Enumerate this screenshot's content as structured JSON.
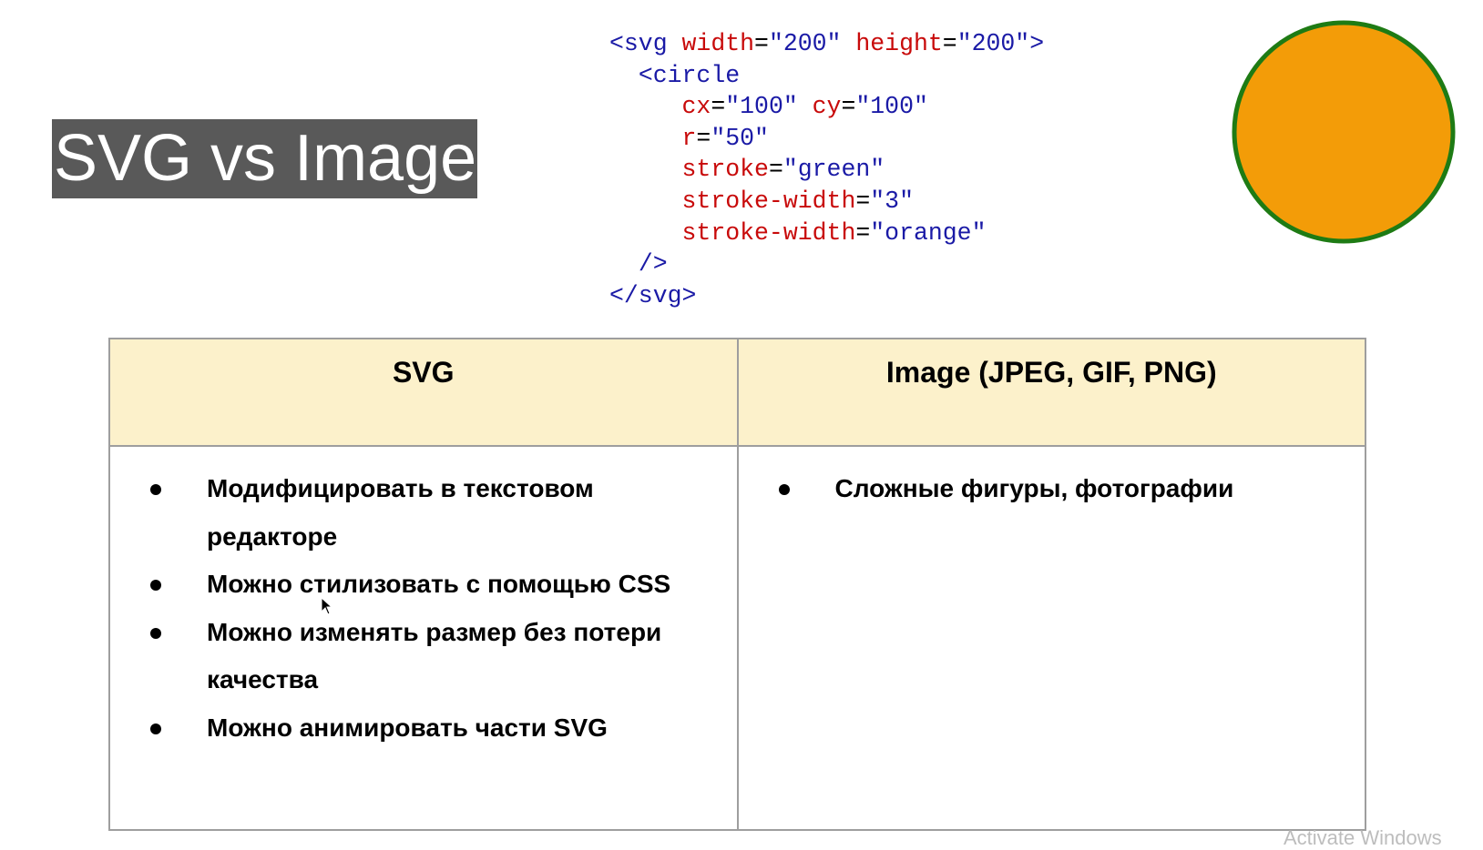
{
  "slide": {
    "title": "SVG vs Image"
  },
  "code": {
    "lines": [
      [
        {
          "t": "tag",
          "v": "<svg "
        },
        {
          "t": "attr",
          "v": "width"
        },
        {
          "t": "punct",
          "v": "="
        },
        {
          "t": "val",
          "v": "\"200\" "
        },
        {
          "t": "attr",
          "v": "height"
        },
        {
          "t": "punct",
          "v": "="
        },
        {
          "t": "val",
          "v": "\"200\">"
        }
      ],
      [
        {
          "t": "punct",
          "v": "  "
        },
        {
          "t": "tag",
          "v": "<circle"
        }
      ],
      [
        {
          "t": "punct",
          "v": "     "
        },
        {
          "t": "attr",
          "v": "cx"
        },
        {
          "t": "punct",
          "v": "="
        },
        {
          "t": "val",
          "v": "\"100\" "
        },
        {
          "t": "attr",
          "v": "cy"
        },
        {
          "t": "punct",
          "v": "="
        },
        {
          "t": "val",
          "v": "\"100\""
        }
      ],
      [
        {
          "t": "punct",
          "v": "     "
        },
        {
          "t": "attr",
          "v": "r"
        },
        {
          "t": "punct",
          "v": "="
        },
        {
          "t": "val",
          "v": "\"50\""
        }
      ],
      [
        {
          "t": "punct",
          "v": "     "
        },
        {
          "t": "attr",
          "v": "stroke"
        },
        {
          "t": "punct",
          "v": "="
        },
        {
          "t": "val",
          "v": "\"green\""
        }
      ],
      [
        {
          "t": "punct",
          "v": "     "
        },
        {
          "t": "attr",
          "v": "stroke-width"
        },
        {
          "t": "punct",
          "v": "="
        },
        {
          "t": "val",
          "v": "\"3\""
        }
      ],
      [
        {
          "t": "punct",
          "v": "     "
        },
        {
          "t": "attr",
          "v": "stroke-width"
        },
        {
          "t": "punct",
          "v": "="
        },
        {
          "t": "val",
          "v": "\"orange\""
        }
      ],
      [
        {
          "t": "punct",
          "v": "  "
        },
        {
          "t": "tag",
          "v": "/>"
        }
      ],
      [
        {
          "t": "tag",
          "v": "</svg>"
        }
      ]
    ]
  },
  "circle": {
    "fill": "#f39c08",
    "stroke": "#1e7b14"
  },
  "table": {
    "headers": [
      "SVG",
      "Image (JPEG, GIF, PNG)"
    ],
    "svg_points": [
      "Модифицировать в текстовом редакторе",
      "Можно стилизовать с помощью CSS",
      "Можно изменять размер без потери качества",
      "Можно анимировать части SVG"
    ],
    "image_points": [
      "Сложные фигуры, фотографии"
    ]
  },
  "watermark": "Activate Windows",
  "colors": {
    "title_bg": "#595959",
    "header_bg": "#fcf1cb",
    "code_tag": "#1a1aa6",
    "code_attr": "#c80a0a"
  }
}
